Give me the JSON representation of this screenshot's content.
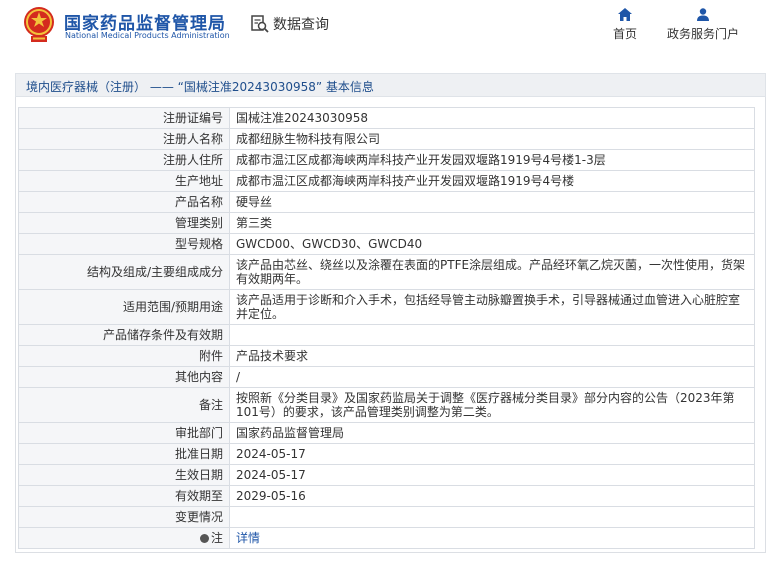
{
  "header": {
    "site_name_cn": "国家药品监督管理局",
    "site_name_en": "National Medical Products Administration",
    "query_label": "数据查询",
    "nav": [
      {
        "label": "首页",
        "icon": "home-icon"
      },
      {
        "label": "政务服务门户",
        "icon": "user-icon"
      }
    ]
  },
  "breadcrumb": {
    "category": "境内医疗器械（注册）",
    "separator": "——",
    "record": "“国械注准20243030958”",
    "suffix": "基本信息"
  },
  "fields": [
    {
      "label": "注册证编号",
      "value": "国械注准20243030958"
    },
    {
      "label": "注册人名称",
      "value": "成都纽脉生物科技有限公司"
    },
    {
      "label": "注册人住所",
      "value": "成都市温江区成都海峡两岸科技产业开发园双堰路1919号4号楼1-3层"
    },
    {
      "label": "生产地址",
      "value": "成都市温江区成都海峡两岸科技产业开发园双堰路1919号4号楼"
    },
    {
      "label": "产品名称",
      "value": "硬导丝"
    },
    {
      "label": "管理类别",
      "value": "第三类"
    },
    {
      "label": "型号规格",
      "value": "GWCD00、GWCD30、GWCD40"
    },
    {
      "label": "结构及组成/主要组成成分",
      "value": "该产品由芯丝、绕丝以及涂覆在表面的PTFE涂层组成。产品经环氧乙烷灭菌，一次性使用，货架有效期两年。"
    },
    {
      "label": "适用范围/预期用途",
      "value": "该产品适用于诊断和介入手术，包括经导管主动脉瓣置换手术，引导器械通过血管进入心脏腔室并定位。"
    },
    {
      "label": "产品储存条件及有效期",
      "value": ""
    },
    {
      "label": "附件",
      "value": "产品技术要求"
    },
    {
      "label": "其他内容",
      "value": "/"
    },
    {
      "label": "备注",
      "value": "按照新《分类目录》及国家药监局关于调整《医疗器械分类目录》部分内容的公告（2023年第101号）的要求，该产品管理类别调整为第二类。"
    },
    {
      "label": "审批部门",
      "value": "国家药品监督管理局"
    },
    {
      "label": "批准日期",
      "value": "2024-05-17"
    },
    {
      "label": "生效日期",
      "value": "2024-05-17"
    },
    {
      "label": "有效期至",
      "value": "2029-05-16"
    },
    {
      "label": "变更情况",
      "value": ""
    }
  ],
  "note_row": {
    "label": "注",
    "link": "详情"
  }
}
